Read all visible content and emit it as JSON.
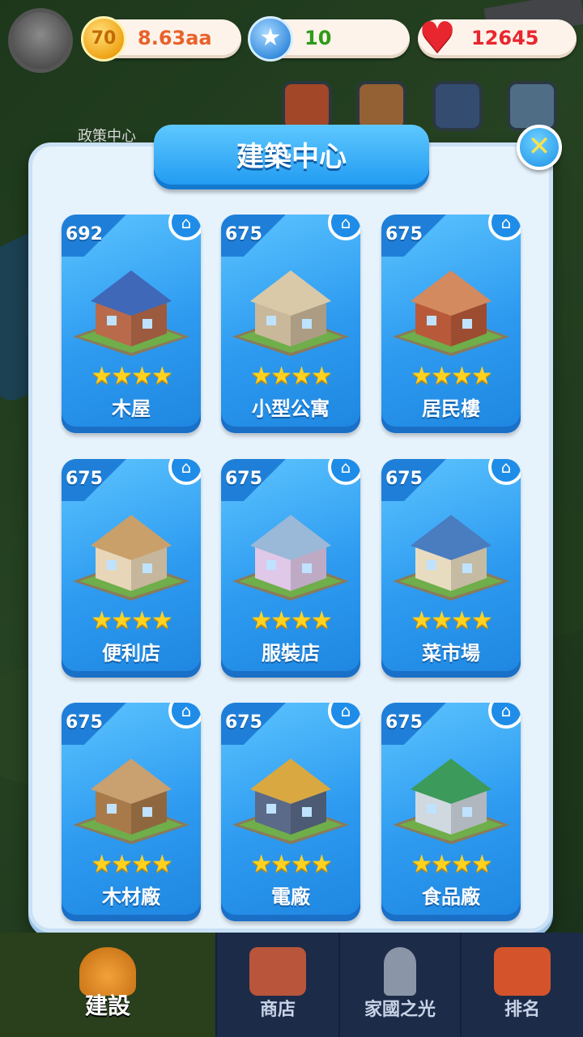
{
  "top_bar": {
    "coins": "8.63aa",
    "coin_icon_text": "70",
    "stars": "10",
    "hearts": "12645"
  },
  "background_label": "政策中心",
  "modal": {
    "title": "建築中心",
    "close_icon": "close-icon"
  },
  "buildings": [
    {
      "count": "692",
      "name": "木屋",
      "stars": "★★★★"
    },
    {
      "count": "675",
      "name": "小型公寓",
      "stars": "★★★★"
    },
    {
      "count": "675",
      "name": "居民樓",
      "stars": "★★★★"
    },
    {
      "count": "675",
      "name": "便利店",
      "stars": "★★★★"
    },
    {
      "count": "675",
      "name": "服裝店",
      "stars": "★★★★"
    },
    {
      "count": "675",
      "name": "菜市場",
      "stars": "★★★★"
    },
    {
      "count": "675",
      "name": "木材廠",
      "stars": "★★★★"
    },
    {
      "count": "675",
      "name": "電廠",
      "stars": "★★★★"
    },
    {
      "count": "675",
      "name": "食品廠",
      "stars": "★★★★"
    }
  ],
  "bottom_nav": [
    {
      "label": "建設",
      "active": true
    },
    {
      "label": "商店",
      "active": false
    },
    {
      "label": "家國之光",
      "active": false
    },
    {
      "label": "排名",
      "active": false
    }
  ],
  "colors": {
    "accent": "#1e98f0",
    "card": "#2d9af0",
    "star": "#ffd21f",
    "heart": "#e8262f"
  }
}
